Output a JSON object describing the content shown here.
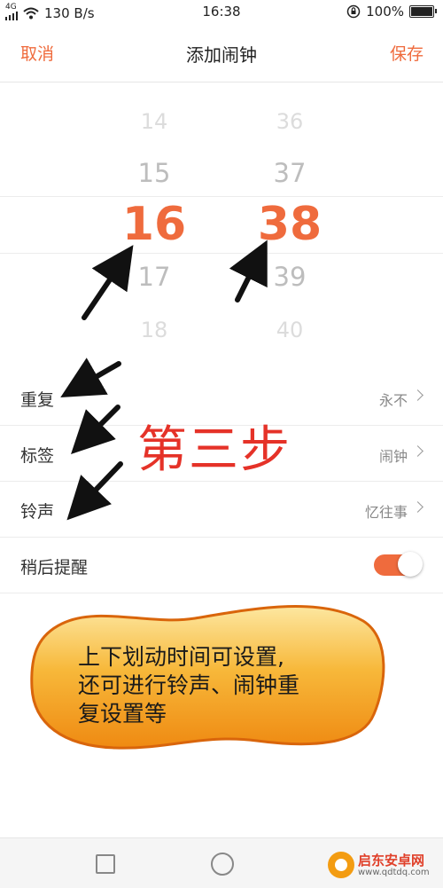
{
  "status_bar": {
    "network": "4G",
    "speed": "130 B/s",
    "time": "16:38",
    "battery": "100%"
  },
  "nav": {
    "cancel": "取消",
    "title": "添加闹钟",
    "save": "保存"
  },
  "picker": {
    "hours": [
      "14",
      "15",
      "16",
      "17",
      "18"
    ],
    "minutes": [
      "36",
      "37",
      "38",
      "39",
      "40"
    ],
    "selected_hour": "16",
    "selected_minute": "38"
  },
  "settings": [
    {
      "label": "重复",
      "value": "永不"
    },
    {
      "label": "标签",
      "value": "闹钟"
    },
    {
      "label": "铃声",
      "value": "忆往事"
    },
    {
      "label": "稍后提醒",
      "value": ""
    }
  ],
  "snooze_toggle_on": true,
  "annotation": {
    "step": "第三步",
    "callout_lines": [
      "上下划动时间可设置,",
      "还可进行铃声、闹钟重",
      "复设置等"
    ]
  },
  "watermark": {
    "brand": "启东安卓网",
    "url": "www.qdtdq.com"
  },
  "colors": {
    "accent": "#ef6b3d",
    "annotation_red": "#e53228",
    "callout_orange": "#f5a21b"
  }
}
